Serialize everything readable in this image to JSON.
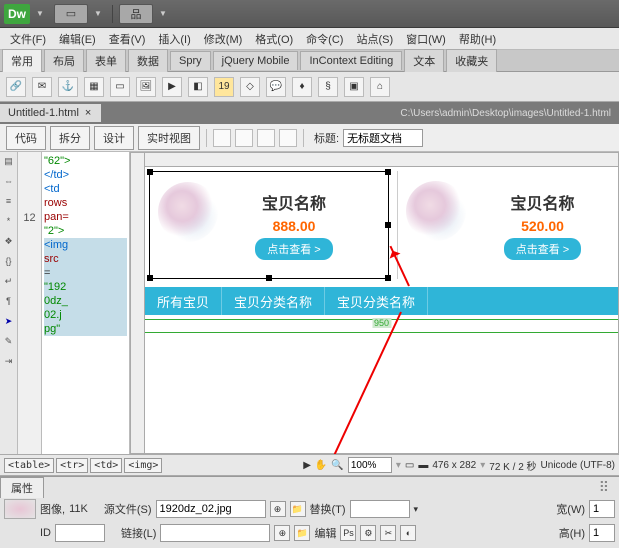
{
  "app": {
    "logo": "Dw"
  },
  "menu": [
    "文件(F)",
    "编辑(E)",
    "查看(V)",
    "插入(I)",
    "修改(M)",
    "格式(O)",
    "命令(C)",
    "站点(S)",
    "窗口(W)",
    "帮助(H)"
  ],
  "tabs": [
    "常用",
    "布局",
    "表单",
    "数据",
    "Spry",
    "jQuery Mobile",
    "InContext Editing",
    "文本",
    "收藏夹"
  ],
  "doc": {
    "name": "Untitled-1.html",
    "close": "×",
    "path": "C:\\Users\\admin\\Desktop\\images\\Untitled-1.html"
  },
  "view": {
    "btns": [
      "代码",
      "拆分",
      "设计",
      "实时视图"
    ],
    "title_label": "标题:",
    "title_value": "无标题文档"
  },
  "code": {
    "line_no": "12",
    "lines": [
      "\"62\">",
      "</td>",
      "",
      "<td",
      "rows",
      "pan=",
      "\"2\">",
      "<img",
      "src",
      "=",
      "\"192",
      "0dz_",
      "02.j",
      "pg\""
    ]
  },
  "design": {
    "card1": {
      "name": "宝贝名称",
      "price": "888.00",
      "btn": "点击查看 >"
    },
    "card2": {
      "name": "宝贝名称",
      "price": "520.00",
      "btn": "点击查看 >"
    },
    "nav": [
      "所有宝贝",
      "宝贝分类名称",
      "宝贝分类名称"
    ],
    "dim": "950"
  },
  "tagsel": {
    "tags": [
      "<table>",
      "<tr>",
      "<td>",
      "<img>"
    ],
    "zoom": "100%",
    "size": "476 x 282",
    "perf": "72 K / 2 秒",
    "enc": "Unicode (UTF-8)"
  },
  "props": {
    "tab": "属性",
    "img_label": "图像,",
    "img_size": "11K",
    "src_label": "源文件(S)",
    "src_value": "1920dz_02.jpg",
    "alt_label": "替换(T)",
    "id_label": "ID",
    "link_label": "链接(L)",
    "edit_label": "编辑",
    "w_label": "宽(W)",
    "h_label": "高(H)",
    "w_value": "1",
    "h_value": "1"
  }
}
